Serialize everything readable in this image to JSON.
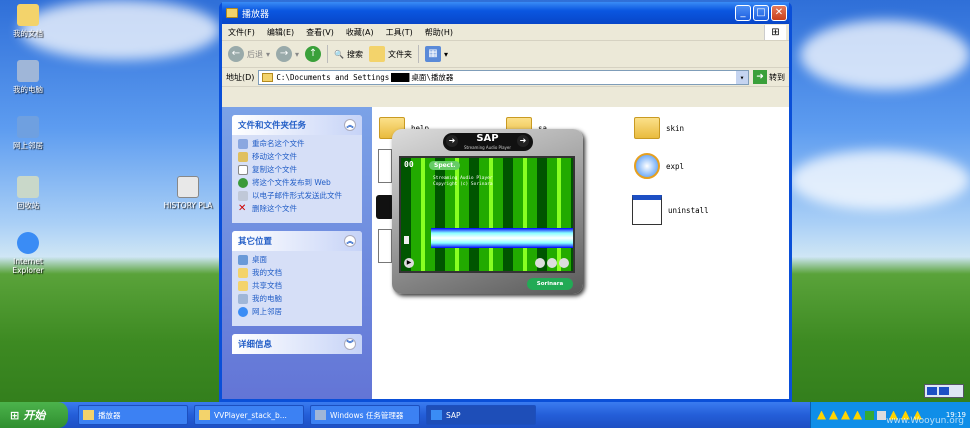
{
  "desktop": {
    "icons": [
      {
        "label": "我的文档",
        "color": "#f3d36b",
        "icon": "my-documents-icon"
      },
      {
        "label": "我的电脑",
        "color": "#9fb6d8",
        "icon": "my-computer-icon"
      },
      {
        "label": "网上邻居",
        "color": "#6fa0e0",
        "icon": "network-icon"
      },
      {
        "label": "回收站",
        "color": "#c9d8c9",
        "icon": "recycle-bin-icon"
      },
      {
        "label": "Internet Explorer",
        "color": "#3a8cf5",
        "icon": "ie-icon"
      },
      {
        "label": "HISTORY PLA",
        "color": "#e8e8e8",
        "icon": "file-icon"
      }
    ]
  },
  "window": {
    "title": "播放器",
    "menu": [
      "文件(F)",
      "编辑(E)",
      "查看(V)",
      "收藏(A)",
      "工具(T)",
      "帮助(H)"
    ],
    "toolbar": {
      "back": "后退",
      "search": "搜索",
      "folders": "文件夹"
    },
    "address": {
      "label": "地址(D)",
      "path": "C:\\Documents and Settings",
      "path_end": "桌面\\播放器",
      "go": "转到"
    }
  },
  "tasks_panel": {
    "title": "文件和文件夹任务",
    "items": [
      "重命名这个文件",
      "移动这个文件",
      "复制这个文件",
      "将这个文件发布到 Web",
      "以电子邮件形式发送此文件",
      "删除这个文件"
    ]
  },
  "places_panel": {
    "title": "其它位置",
    "items": [
      "桌面",
      "我的文档",
      "共享文档",
      "我的电脑",
      "网上邻居"
    ]
  },
  "details_panel": {
    "title": "详细信息"
  },
  "files": [
    {
      "name": "help"
    },
    {
      "name": "sa"
    },
    {
      "name": "skin"
    },
    {
      "name": "expl"
    },
    {
      "name": "uninstall"
    }
  ],
  "sap": {
    "logo": "SAP",
    "subtitle": "Streaming Audio Player",
    "spect": "Spect.",
    "number": "00",
    "info_line1": "Streaming Audio Player",
    "info_line2": "Copyright (c) Sorinara",
    "brand": "Sorinara"
  },
  "taskbar": {
    "start": "开始",
    "tasks": [
      "播放器",
      "VVPlayer_stack_b...",
      "Windows 任务管理器",
      "SAP"
    ],
    "clock": "19:19"
  },
  "watermark": "www.Wooyun.org"
}
